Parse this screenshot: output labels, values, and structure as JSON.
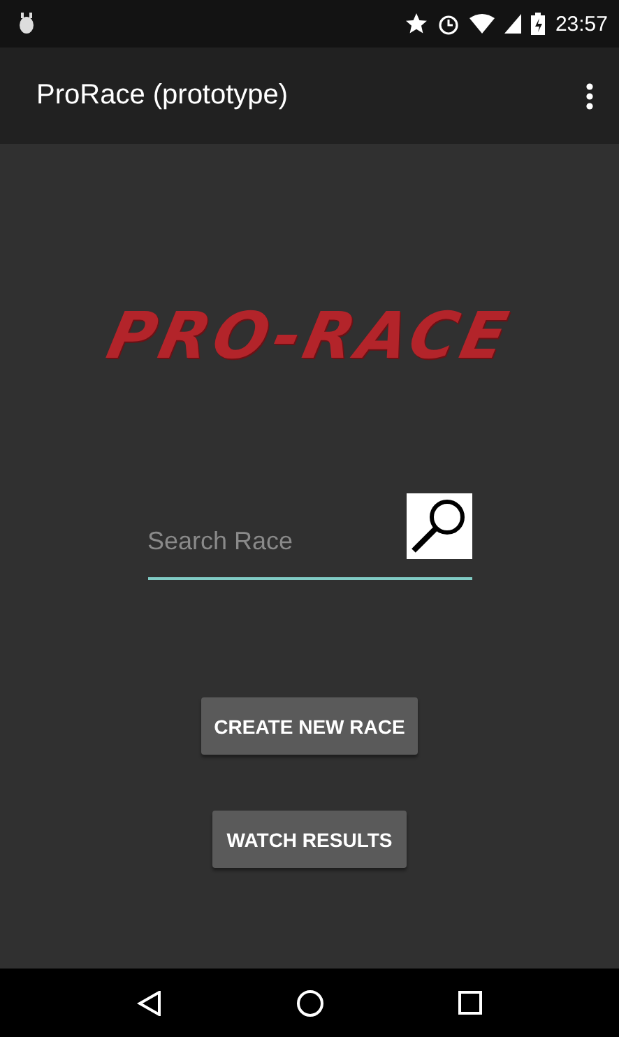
{
  "status_bar": {
    "time": "23:57"
  },
  "app_bar": {
    "title": "ProRace (prototype)"
  },
  "logo": {
    "text": "PRO-RACE"
  },
  "search": {
    "placeholder": "Search Race"
  },
  "buttons": [
    "CREATE NEW RACE",
    "WATCH RESULTS"
  ]
}
